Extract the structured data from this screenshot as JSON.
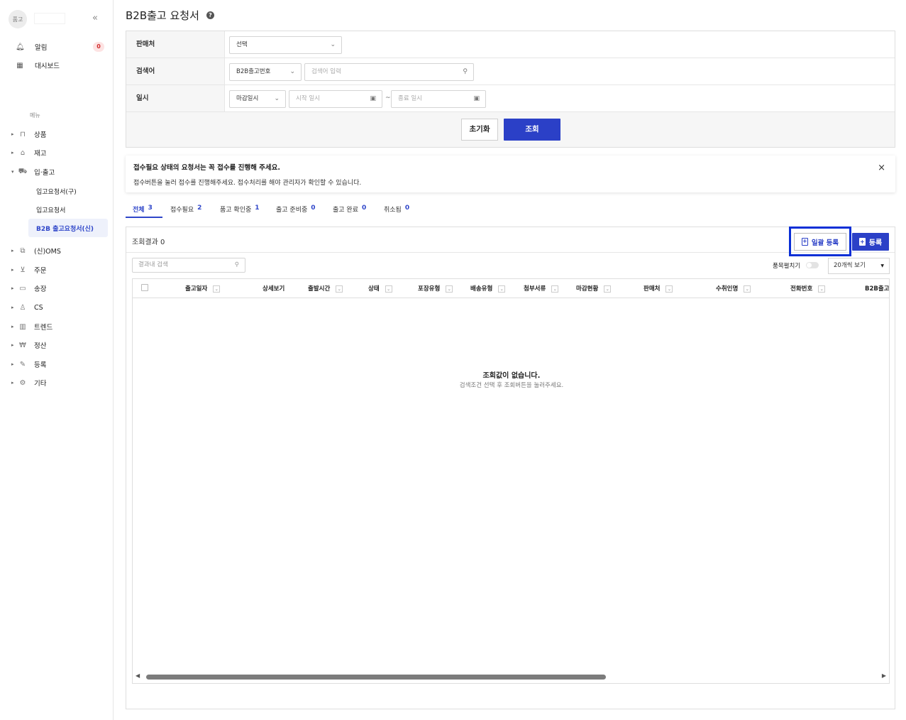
{
  "sidebar": {
    "brand_initials": "품고",
    "collapse_icon": "«",
    "top_items": [
      {
        "label": "알림",
        "icon": "bell-icon",
        "badge": "0"
      },
      {
        "label": "대시보드",
        "icon": "dashboard-icon"
      }
    ],
    "menu_title": "메뉴",
    "nav": [
      {
        "label": "상품",
        "icon": "bag-icon"
      },
      {
        "label": "재고",
        "icon": "warehouse-icon"
      },
      {
        "label": "입·출고",
        "icon": "truck-icon"
      },
      {
        "label": "(신)OMS",
        "icon": "oms-icon"
      },
      {
        "label": "주문",
        "icon": "cart-icon"
      },
      {
        "label": "송장",
        "icon": "invoice-icon"
      },
      {
        "label": "CS",
        "icon": "person-icon"
      },
      {
        "label": "트렌드",
        "icon": "chart-icon"
      },
      {
        "label": "정산",
        "icon": "won-icon"
      },
      {
        "label": "등록",
        "icon": "pencil-icon"
      },
      {
        "label": "기타",
        "icon": "gear-icon"
      }
    ],
    "sub_items": [
      "입고요청서(구)",
      "입고요청서",
      "B2B 출고요청서(신)"
    ]
  },
  "page": {
    "title": "B2B출고 요청서",
    "help_icon": "?"
  },
  "filter": {
    "seller_label": "판매처",
    "seller_value": "선택",
    "keyword_label": "검색어",
    "keyword_type": "B2B출고번호",
    "keyword_placeholder": "검색어 입력",
    "date_label": "일시",
    "date_type": "마감일시",
    "start_placeholder": "시작 일시",
    "end_placeholder": "종료 일시",
    "tilde": "~",
    "reset_label": "초기화",
    "search_label": "조회"
  },
  "notice": {
    "line1": "접수필요 상태의 요청서는 꼭 접수를 진행해 주세요.",
    "line2": "접수버튼을 눌러 접수를 진행해주세요. 접수처리를 해야 관리자가 확인할 수 있습니다.",
    "close": "×"
  },
  "tabs": [
    {
      "label": "전체",
      "count": "3"
    },
    {
      "label": "접수필요",
      "count": "2"
    },
    {
      "label": "품고 확인중",
      "count": "1"
    },
    {
      "label": "출고 준비중",
      "count": "0"
    },
    {
      "label": "출고 완료",
      "count": "0"
    },
    {
      "label": "취소됨",
      "count": "0"
    }
  ],
  "results": {
    "count_label": "조회결과 0",
    "bulk_register_label": "일괄 등록",
    "register_label": "등록",
    "inner_search_placeholder": "결과내 검색",
    "toggle_label": "품목펼치기",
    "per_page": "20개씩 보기",
    "columns": [
      "출고일자",
      "상세보기",
      "출발시간",
      "상태",
      "포장유형",
      "배송유형",
      "첨부서류",
      "마감현황",
      "판매처",
      "수취인명",
      "전화번호",
      "B2B출고"
    ],
    "empty_title": "조회값이 없습니다.",
    "empty_sub": "검색조건 선택 후 조회버튼을 눌러주세요."
  },
  "colors": {
    "accent": "#2b40c7",
    "highlight": "#0a2fd6",
    "badge": "#d12c2c"
  }
}
